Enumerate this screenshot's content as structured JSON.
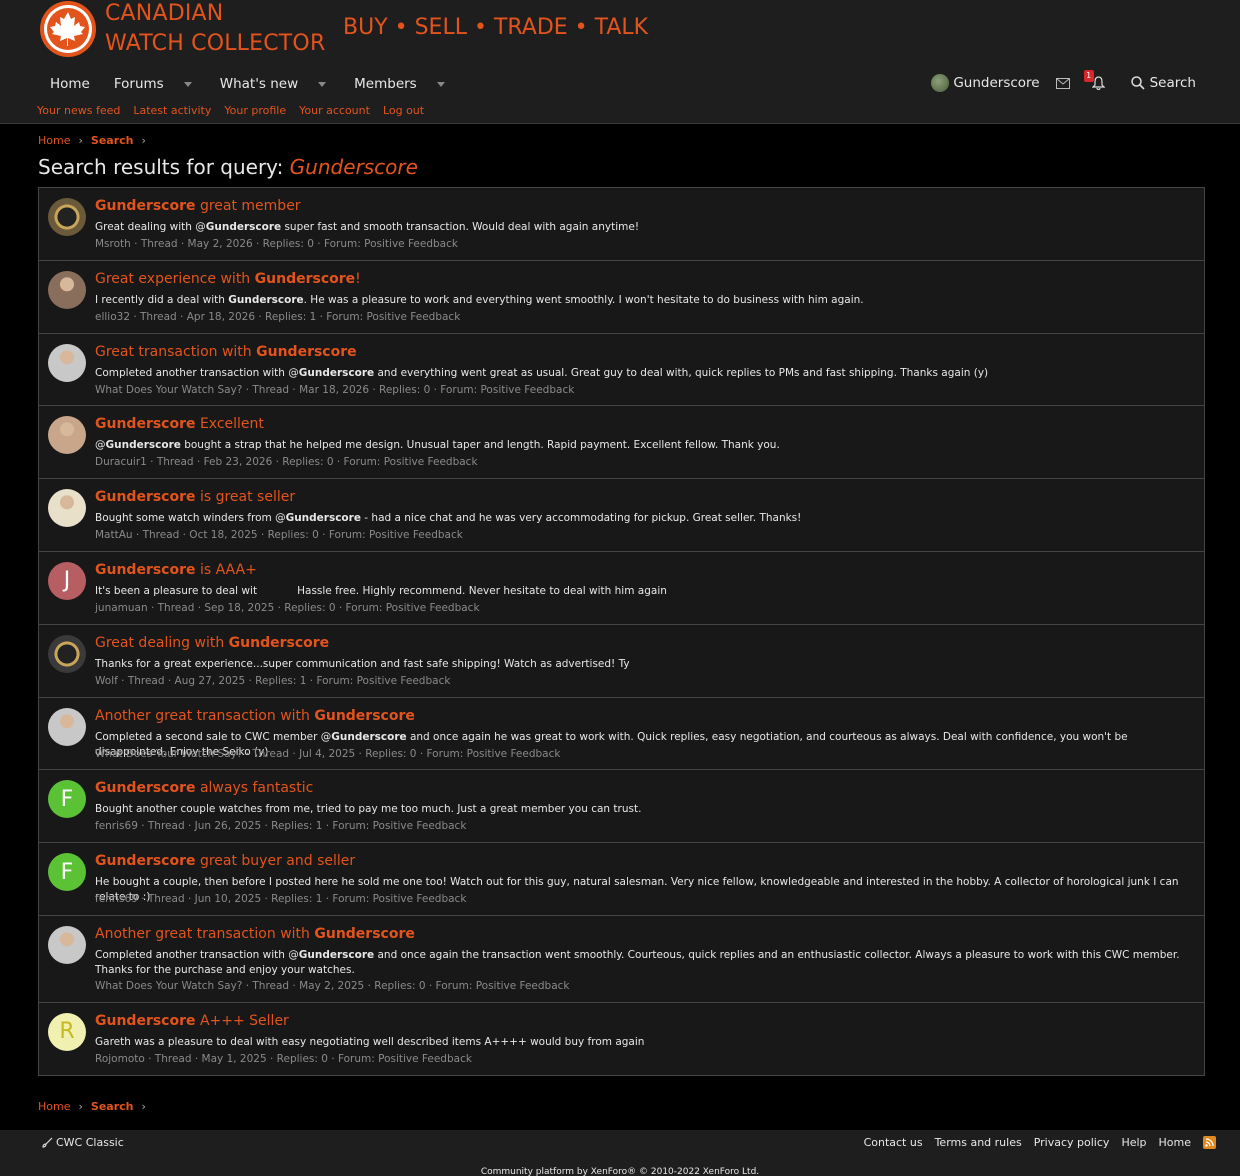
{
  "brand": {
    "line1": "CANADIAN",
    "line2": "WATCH COLLECTOR",
    "tagline": "BUY • SELL • TRADE • TALK"
  },
  "nav": {
    "items": [
      {
        "label": "Home"
      },
      {
        "label": "Forums"
      },
      {
        "label": "What's new"
      },
      {
        "label": "Members"
      }
    ]
  },
  "user": {
    "name": "Gunderscore",
    "alerts_badge": "1",
    "search_label": "Search"
  },
  "subnav": [
    "Your news feed",
    "Latest activity",
    "Your profile",
    "Your account",
    "Log out"
  ],
  "breadcrumb": {
    "home": "Home",
    "current": "Search"
  },
  "page": {
    "title_prefix": "Search results for query:",
    "query": "Gunderscore"
  },
  "results": [
    {
      "title_pre": "",
      "title_bold": "Gunderscore",
      "title_post": " great member",
      "body_pre": "Great dealing with @",
      "body_bold": "Gunderscore",
      "body_post": " super fast and smooth transaction. Would deal with again anytime!",
      "meta": "Msroth · Thread · May 2, 2026 · Replies: 0 · Forum: Positive Feedback"
    },
    {
      "title_pre": "Great experience with ",
      "title_bold": "Gunderscore",
      "title_post": "!",
      "body_pre": "I recently did a deal with ",
      "body_bold": "Gunderscore",
      "body_post": ". He was a pleasure to work and everything went smoothly. I won't hesitate to do business with him again.",
      "meta": "ellio32 · Thread · Apr 18, 2026 · Replies: 1 · Forum: Positive Feedback"
    },
    {
      "title_pre": "Great transaction with ",
      "title_bold": "Gunderscore",
      "title_post": "",
      "body_pre": "Completed another transaction with @",
      "body_bold": "Gunderscore",
      "body_post": " and everything went great as usual. Great guy to deal with, quick replies to PMs and fast shipping. Thanks again (y)",
      "meta": "What Does Your Watch Say? · Thread · Mar 18, 2026 · Replies: 0 · Forum: Positive Feedback"
    },
    {
      "title_pre": "",
      "title_bold": "Gunderscore",
      "title_post": " Excellent",
      "body_pre": "@",
      "body_bold": "Gunderscore",
      "body_post": " bought a strap that he helped me design. Unusual taper and length. Rapid payment. Excellent fellow. Thank you.",
      "meta": "Duracuir1 · Thread · Feb 23, 2026 · Replies: 0 · Forum: Positive Feedback"
    },
    {
      "title_pre": "",
      "title_bold": "Gunderscore",
      "title_post": " is great seller",
      "body_pre": "Bought some watch winders from @",
      "body_bold": "Gunderscore",
      "body_post": " - had a nice chat and he was very accommodating for pickup. Great seller. Thanks!",
      "meta": "MattAu · Thread · Oct 18, 2025 · Replies: 0 · Forum: Positive Feedback"
    },
    {
      "title_pre": "",
      "title_bold": "Gunderscore",
      "title_post": " is AAA+",
      "body_pre": "It's been a pleasure to deal wit",
      "body_bold": "",
      "body_post": "            Hassle free. Highly recommend. Never hesitate to deal with him again",
      "meta": "junamuan · Thread · Sep 18, 2025 · Replies: 0 · Forum: Positive Feedback"
    },
    {
      "title_pre": "Great dealing with ",
      "title_bold": "Gunderscore",
      "title_post": "",
      "body_pre": "Thanks for a great experience...super communication and fast safe shipping! Watch as advertised! Ty",
      "body_bold": "",
      "body_post": "",
      "meta": "Wolf · Thread · Aug 27, 2025 · Replies: 1 · Forum: Positive Feedback"
    },
    {
      "title_pre": "Another great transaction with ",
      "title_bold": "Gunderscore",
      "title_post": "",
      "body_pre": "Completed a second sale to CWC member @",
      "body_bold": "Gunderscore",
      "body_post": " and once again he was great to work with. Quick replies, easy negotiation, and courteous as always. Deal with confidence, you won't be disappointed. Enjoy the Seiko (y)",
      "meta": "What Does Your Watch Say? · Thread · Jul 4, 2025 · Replies: 0 · Forum: Positive Feedback"
    },
    {
      "title_pre": "",
      "title_bold": "Gunderscore",
      "title_post": " always fantastic",
      "body_pre": "Bought another couple watches from me, tried to pay me too much. Just a great member you can trust.",
      "body_bold": "",
      "body_post": "",
      "meta": "fenris69 · Thread · Jun 26, 2025 · Replies: 1 · Forum: Positive Feedback"
    },
    {
      "title_pre": "",
      "title_bold": "Gunderscore",
      "title_post": " great buyer and seller",
      "body_pre": "He bought a couple, then before I posted here he sold me one too! Watch out for this guy, natural salesman. Very nice fellow, knowledgeable and interested in the hobby. A collector of horological junk I can relate to :)",
      "body_bold": "",
      "body_post": "",
      "meta": "fenris69 · Thread · Jun 10, 2025 · Replies: 1 · Forum: Positive Feedback"
    },
    {
      "title_pre": "Another great transaction with ",
      "title_bold": "Gunderscore",
      "title_post": "",
      "body_pre": "Completed another transaction with @",
      "body_bold": "Gunderscore",
      "body_post": " and once again the transaction went smoothly. Courteous, quick replies and an enthusiastic collector. Always a pleasure to work with this CWC member. Thanks for the purchase and enjoy your watches.",
      "meta": "What Does Your Watch Say? · Thread · May 2, 2025 · Replies: 0 · Forum: Positive Feedback"
    },
    {
      "title_pre": "",
      "title_bold": "Gunderscore",
      "title_post": " A+++ Seller",
      "body_pre": "Gareth was a pleasure to deal with easy negotiating well described items A++++ would buy from again",
      "body_bold": "",
      "body_post": "",
      "meta": "Rojomoto · Thread · May 1, 2025 · Replies: 0 · Forum: Positive Feedback"
    }
  ],
  "avatars": [
    {
      "kind": "watch",
      "bg": "#6b5a3a",
      "letter": ""
    },
    {
      "kind": "photo",
      "bg": "#8a6e5c",
      "letter": ""
    },
    {
      "kind": "photo",
      "bg": "#c8c8c8",
      "letter": ""
    },
    {
      "kind": "photo",
      "bg": "#c9a58a",
      "letter": ""
    },
    {
      "kind": "photo",
      "bg": "#e8e0c8",
      "letter": ""
    },
    {
      "kind": "letter",
      "bg": "#b75e62",
      "letter": "J"
    },
    {
      "kind": "watch",
      "bg": "#3a3a3a",
      "letter": ""
    },
    {
      "kind": "photo",
      "bg": "#c8c8c8",
      "letter": ""
    },
    {
      "kind": "letter",
      "bg": "#5bc236",
      "letter": "F"
    },
    {
      "kind": "letter",
      "bg": "#5bc236",
      "letter": "F"
    },
    {
      "kind": "photo",
      "bg": "#c8c8c8",
      "letter": ""
    },
    {
      "kind": "letter",
      "bg": "#f0f0b0",
      "letter": "R",
      "fg": "#c8b820"
    }
  ],
  "footer": {
    "style_label": "CWC Classic",
    "links": [
      "Contact us",
      "Terms and rules",
      "Privacy policy",
      "Help",
      "Home"
    ],
    "copyright": "Community platform by XenForo® © 2010-2022 XenForo Ltd."
  },
  "colors": {
    "accent": "#e3541d",
    "header_bg": "#1e1e1e",
    "page_bg": "#000000",
    "meta": "#8a8a8a"
  }
}
